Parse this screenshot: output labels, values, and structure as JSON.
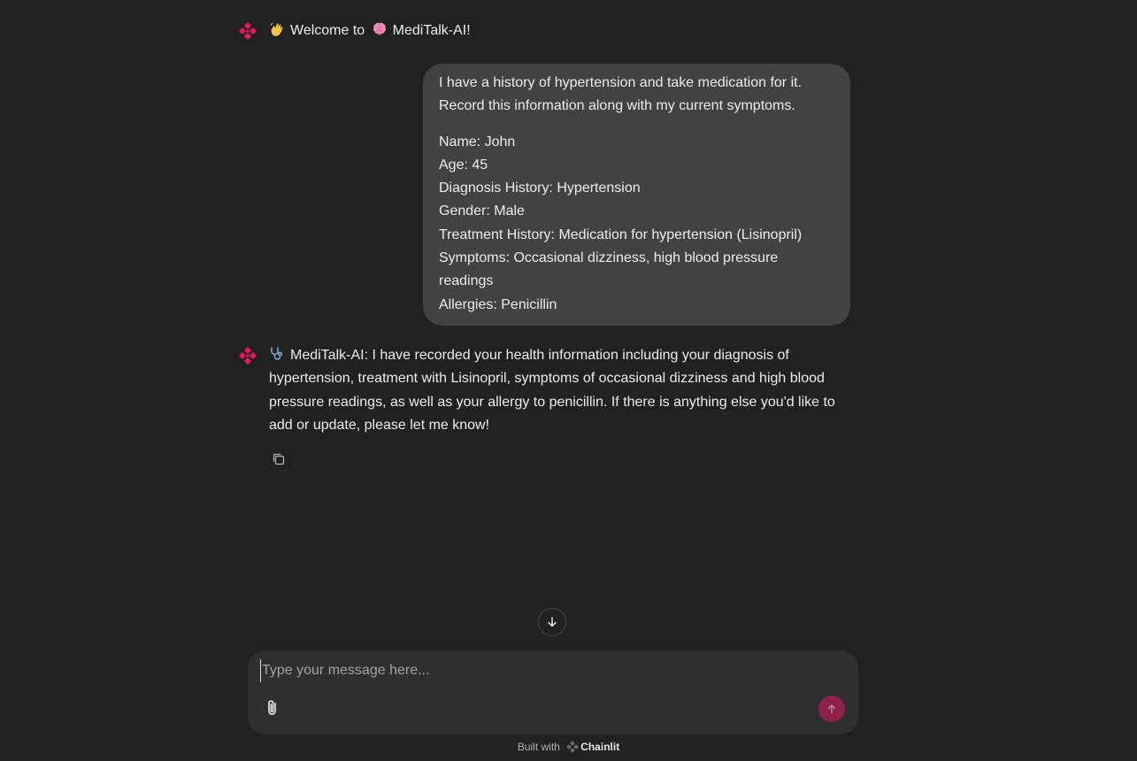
{
  "welcome": {
    "text": "Welcome to",
    "app_name": "MediTalk-AI!"
  },
  "user_message": {
    "intro": "I have a history of hypertension and take medication for it. Record this information along with my current symptoms.",
    "fields": [
      "Name: John",
      "Age: 45",
      "Diagnosis History: Hypertension",
      "Gender: Male",
      "Treatment History: Medication for hypertension (Lisinopril)",
      "Symptoms: Occasional dizziness, high blood pressure readings",
      "Allergies: Penicillin"
    ]
  },
  "assistant_reply": {
    "text": "MediTalk-AI: I have recorded your health information including your diagnosis of hypertension, treatment with Lisinopril, symptoms of occasional dizziness and high blood pressure readings, as well as your allergy to penicillin. If there is anything else you'd like to add or update, please let me know!"
  },
  "composer": {
    "placeholder": "Type your message here..."
  },
  "footer": {
    "built_with": "Built with",
    "brand": "Chainlit"
  },
  "icons": {
    "avatar": "flower-logo-icon",
    "wave": "waving-hand-icon",
    "brain": "brain-icon",
    "stethoscope": "stethoscope-icon",
    "copy": "copy-icon",
    "scroll": "arrow-down-icon",
    "attach": "paperclip-icon",
    "send": "arrow-up-icon"
  },
  "colors": {
    "background": "#212121",
    "user_bubble": "#424242",
    "composer": "#2f2f2f",
    "accent": "#e6175c",
    "send_button": "#8e1f48"
  }
}
